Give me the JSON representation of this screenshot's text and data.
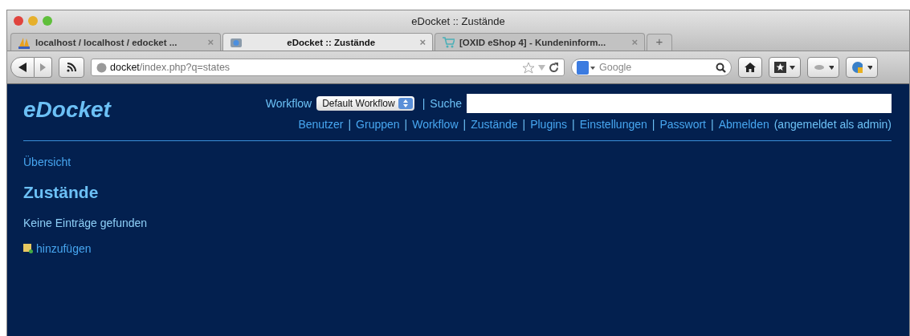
{
  "window": {
    "title": "eDocket :: Zustände"
  },
  "tabs": [
    {
      "label": "localhost / localhost / edocket ...",
      "selected": false,
      "close": "×"
    },
    {
      "label": "eDocket :: Zustände",
      "selected": true,
      "close": "×"
    },
    {
      "label": "[OXID eShop 4] - Kundeninform...",
      "selected": false,
      "close": "×"
    }
  ],
  "new_tab": "+",
  "address": {
    "host": "docket",
    "path": "/index.php?q=states"
  },
  "search": {
    "placeholder": "Google"
  },
  "page": {
    "logo": "eDocket",
    "workflow_label": "Workflow",
    "workflow_select": "Default Workflow",
    "search_separator": "|",
    "search_label": "Suche",
    "nav": [
      {
        "kind": "link",
        "text": "Benutzer"
      },
      {
        "kind": "sep",
        "text": "|"
      },
      {
        "kind": "link",
        "text": "Gruppen"
      },
      {
        "kind": "sep",
        "text": "|"
      },
      {
        "kind": "link",
        "text": "Workflow"
      },
      {
        "kind": "sep",
        "text": "|"
      },
      {
        "kind": "link",
        "text": "Zustände"
      },
      {
        "kind": "sep",
        "text": "|"
      },
      {
        "kind": "link",
        "text": "Plugins"
      },
      {
        "kind": "sep",
        "text": "|"
      },
      {
        "kind": "link",
        "text": "Einstellungen"
      },
      {
        "kind": "sep",
        "text": "|"
      },
      {
        "kind": "link",
        "text": "Passwort"
      },
      {
        "kind": "sep",
        "text": "|"
      },
      {
        "kind": "link",
        "text": "Abmelden"
      },
      {
        "kind": "note",
        "text": "(angemeldet als admin)"
      }
    ],
    "breadcrumb": "Übersicht",
    "heading": "Zustände",
    "message": "Keine Einträge gefunden",
    "add_link": "hinzufügen"
  }
}
